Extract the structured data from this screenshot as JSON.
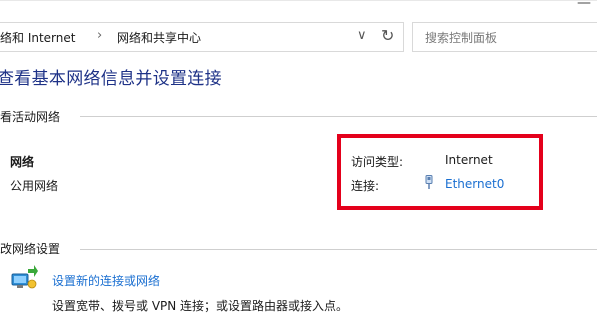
{
  "address_bar": {
    "crumbs": [
      "络和 Internet",
      "网络和共享中心"
    ],
    "separator": "›",
    "dropdown_icon": "chevron-down-icon",
    "refresh_icon": "refresh-icon"
  },
  "search": {
    "placeholder": "搜索控制面板"
  },
  "page_title": "查看基本网络信息并设置连接",
  "active_networks": {
    "label": "看活动网络",
    "network_name": "网络",
    "network_category": "公用网络",
    "access_type_label": "访问类型:",
    "access_type_value": "Internet",
    "connection_label": "连接:",
    "connection_value": "Ethernet0",
    "connection_icon": "ethernet-icon"
  },
  "change_settings": {
    "label": "改网络设置",
    "setup_link": "设置新的连接或网络",
    "setup_desc": "设置宽带、拨号或 VPN 连接；或设置路由器或接入点。",
    "setup_icon": "network-setup-icon"
  },
  "colors": {
    "title": "#1e3287",
    "link": "#1a6fd1",
    "highlight_box": "#e4001b"
  }
}
